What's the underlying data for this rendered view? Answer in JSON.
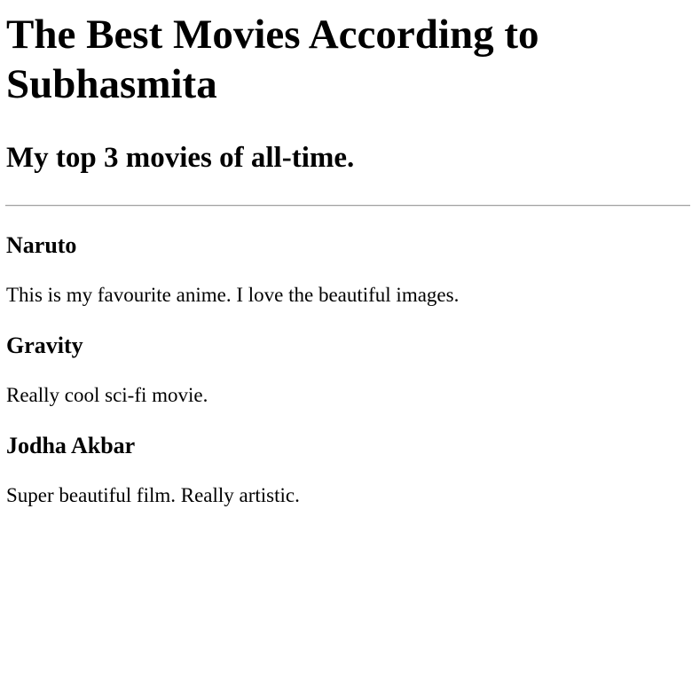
{
  "page": {
    "title": "The Best Movies According to Subhasmita",
    "subtitle": "My top 3 movies of all-time."
  },
  "movies": [
    {
      "title": "Naruto",
      "description": "This is my favourite anime. I love the beautiful images."
    },
    {
      "title": "Gravity",
      "description": "Really cool sci-fi movie."
    },
    {
      "title": "Jodha Akbar",
      "description": "Super beautiful film. Really artistic."
    }
  ]
}
